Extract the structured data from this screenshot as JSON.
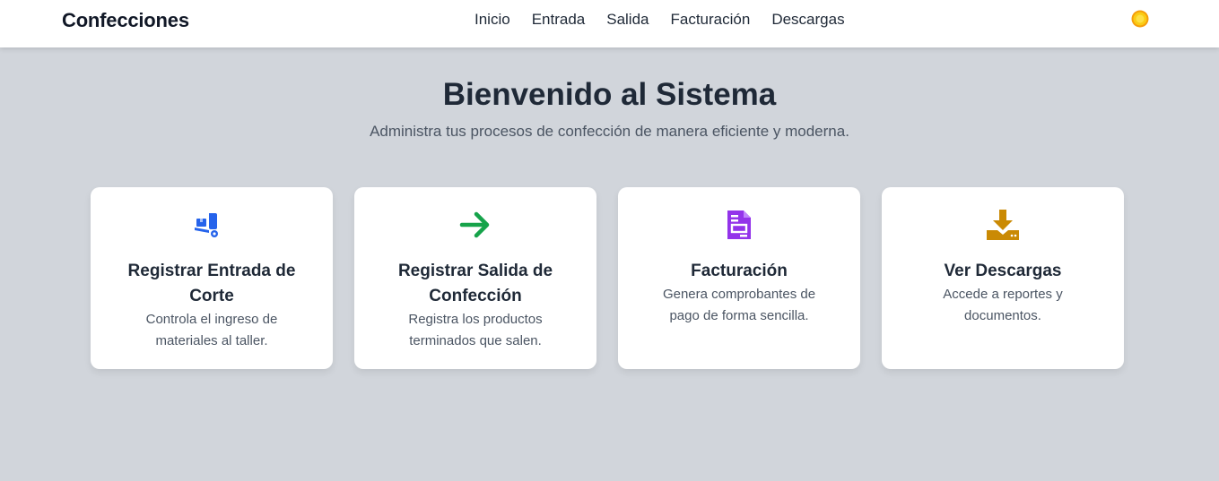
{
  "navbar": {
    "brand": "Confecciones",
    "links": [
      "Inicio",
      "Entrada",
      "Salida",
      "Facturación",
      "Descargas"
    ],
    "theme_icon": "sun-icon"
  },
  "hero": {
    "title": "Bienvenido al Sistema",
    "subtitle": "Administra tus procesos de confección de manera eficiente y moderna."
  },
  "cards": [
    {
      "icon": "dolly-icon",
      "color": "#2563eb",
      "title": "Registrar Entrada de Corte",
      "description": "Controla el ingreso de materiales al taller."
    },
    {
      "icon": "arrow-right-icon",
      "color": "#16a34a",
      "title": "Registrar Salida de Confección",
      "description": "Registra los productos terminados que salen."
    },
    {
      "icon": "invoice-icon",
      "color": "#9333ea",
      "title": "Facturación",
      "description": "Genera comprobantes de pago de forma sencilla."
    },
    {
      "icon": "download-icon",
      "color": "#ca8a04",
      "title": "Ver Descargas",
      "description": "Accede a reportes y documentos."
    }
  ],
  "colors": {
    "background": "#d1d5db",
    "navbar": "#ffffff",
    "sun": "#facc15"
  }
}
